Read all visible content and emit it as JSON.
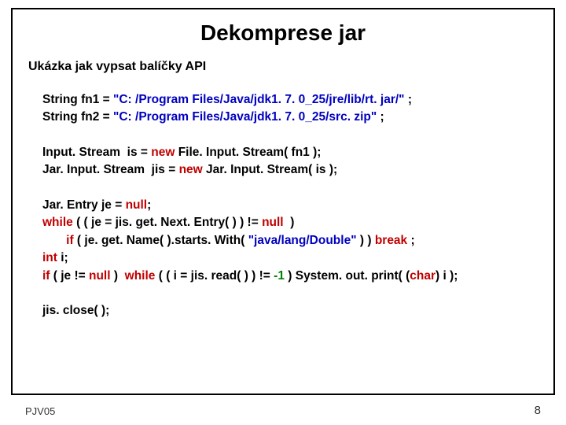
{
  "title": "Dekomprese  jar",
  "subtitle": "Ukázka jak vypsat  balíčky API",
  "code": {
    "l1_a": "String fn1 = ",
    "l1_str": "\"C: /Program Files/Java/jdk1. 7. 0_25/jre/lib/rt. jar/\"",
    "l1_b": " ;",
    "l2_a": "String fn2 = ",
    "l2_str": "\"C: /Program Files/Java/jdk1. 7. 0_25/src. zip\"",
    "l2_b": " ;",
    "l3_a": "Input. Stream  is = ",
    "l3_new": "new",
    "l3_b": " File. Input. Stream( fn1 );",
    "l4_a": "Jar. Input. Stream  jis = ",
    "l4_new": "new",
    "l4_b": " Jar. Input. Stream( is );",
    "l5_a": "Jar. Entry je = ",
    "l5_null": "null",
    "l5_b": ";",
    "l6_while": "while",
    "l6_a": " ( ( je = jis. get. Next. Entry( ) ) != ",
    "l6_null": "null",
    "l6_b": "  )",
    "l7_if": "       if",
    "l7_a": " ( je. get. Name( ).starts. With( ",
    "l7_str": "\"java/lang/Double\"",
    "l7_b": " ) ) ",
    "l7_break": "break",
    "l7_c": " ;",
    "l8_int": "int",
    "l8_a": " i;",
    "l9_if": "if",
    "l9_a": " ( je != ",
    "l9_null": "null",
    "l9_b": " )  ",
    "l9_while": "while",
    "l9_c": " ( ( i = jis. read( ) ) != ",
    "l9_neg1": "-1",
    "l9_d": " ) System. out. print( (",
    "l9_char": "char",
    "l9_e": ") i );",
    "l10": "jis. close( );"
  },
  "footer_left": "PJV05",
  "page_number": "8"
}
